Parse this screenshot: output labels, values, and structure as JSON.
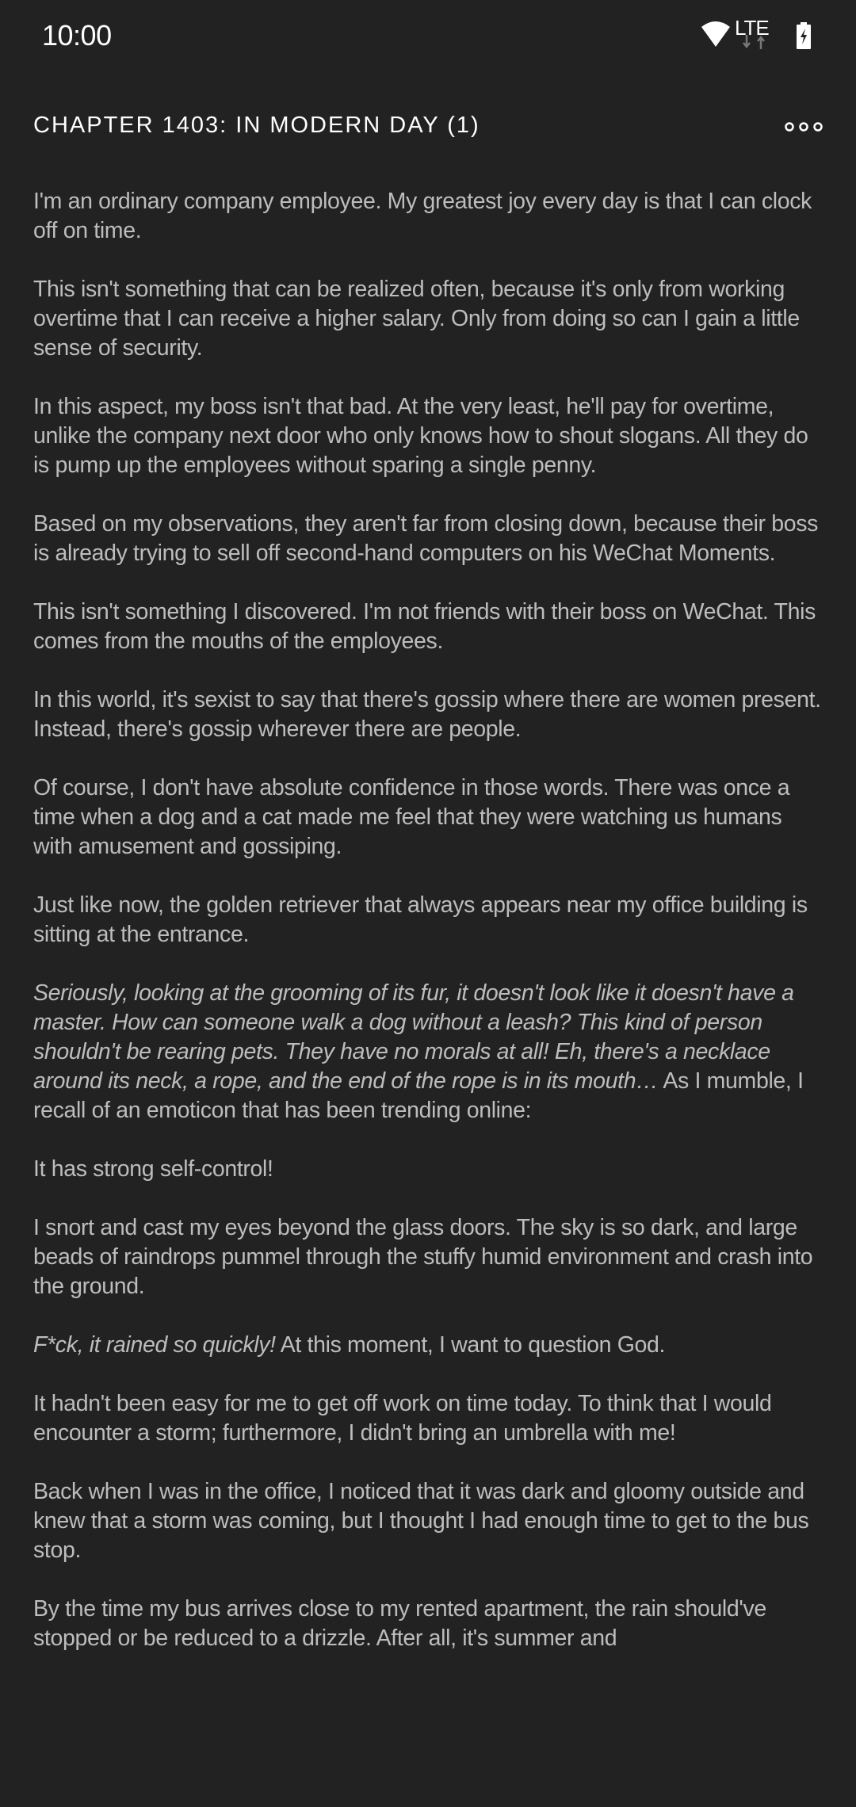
{
  "status_bar": {
    "time": "10:00",
    "network": "LTE",
    "icons": [
      "wifi-icon",
      "lte-data-arrows-icon",
      "battery-charging-icon"
    ]
  },
  "app_bar": {
    "title": "CHAPTER 1403: IN MODERN DAY (1)",
    "menu_icon": "more-options-icon"
  },
  "colors": {
    "background": "#222222",
    "text": "#bdbdbd",
    "title": "#ffffff"
  },
  "paragraphs": [
    [
      {
        "text": "I'm an ordinary company employee. My greatest joy every day is that I can clock off on time."
      }
    ],
    [
      {
        "text": "This isn't something that can be realized often, because it's only from working overtime that I can receive a higher salary. Only from doing so can I gain a little sense of security."
      }
    ],
    [
      {
        "text": "In this aspect, my boss isn't that bad. At the very least, he'll pay for overtime, unlike the company next door who only knows how to shout slogans. All they do is pump up the employees without sparing a single penny."
      }
    ],
    [
      {
        "text": "Based on my observations, they aren't far from closing down, because their boss is already trying to sell off second-hand computers on his WeChat Moments."
      }
    ],
    [
      {
        "text": "This isn't something I discovered. I'm not friends with their boss on WeChat. This comes from the mouths of the employees."
      }
    ],
    [
      {
        "text": "In this world, it's sexist to say that there's gossip where there are women present. Instead, there's gossip wherever there are people."
      }
    ],
    [
      {
        "text": "Of course, I don't have absolute confidence in those words. There was once a time when a dog and a cat made me feel that they were watching us humans with amusement and gossiping."
      }
    ],
    [
      {
        "text": "Just like now, the golden retriever that always appears near my office building is sitting at the entrance."
      }
    ],
    [
      {
        "text": "Seriously, looking at the grooming of its fur, it doesn't look like it doesn't have a master. How can someone walk a dog without a leash? This kind of person shouldn't be rearing pets. They have no morals at all! Eh, there's a necklace around its neck, a rope, and the end of the rope is in its mouth…",
        "italic": true
      },
      {
        "text": " As I mumble, I recall of an emoticon that has been trending online:"
      }
    ],
    [
      {
        "text": "It has strong self-control!"
      }
    ],
    [
      {
        "text": "I snort and cast my eyes beyond the glass doors. The sky is so dark, and large beads of raindrops pummel through the stuffy humid environment and crash into the ground."
      }
    ],
    [
      {
        "text": "F*ck, it rained so quickly!",
        "italic": true
      },
      {
        "text": " At this moment, I want to question God."
      }
    ],
    [
      {
        "text": "It hadn't been easy for me to get off work on time today. To think that I would encounter a storm; furthermore, I didn't bring an umbrella with me!"
      }
    ],
    [
      {
        "text": "Back when I was in the office, I noticed that it was dark and gloomy outside and knew that a storm was coming, but I thought I had enough time to get to the bus stop."
      }
    ],
    [
      {
        "text": "By the time my bus arrives close to my rented apartment, the rain should've stopped or be reduced to a drizzle. After all, it's summer and"
      }
    ]
  ]
}
